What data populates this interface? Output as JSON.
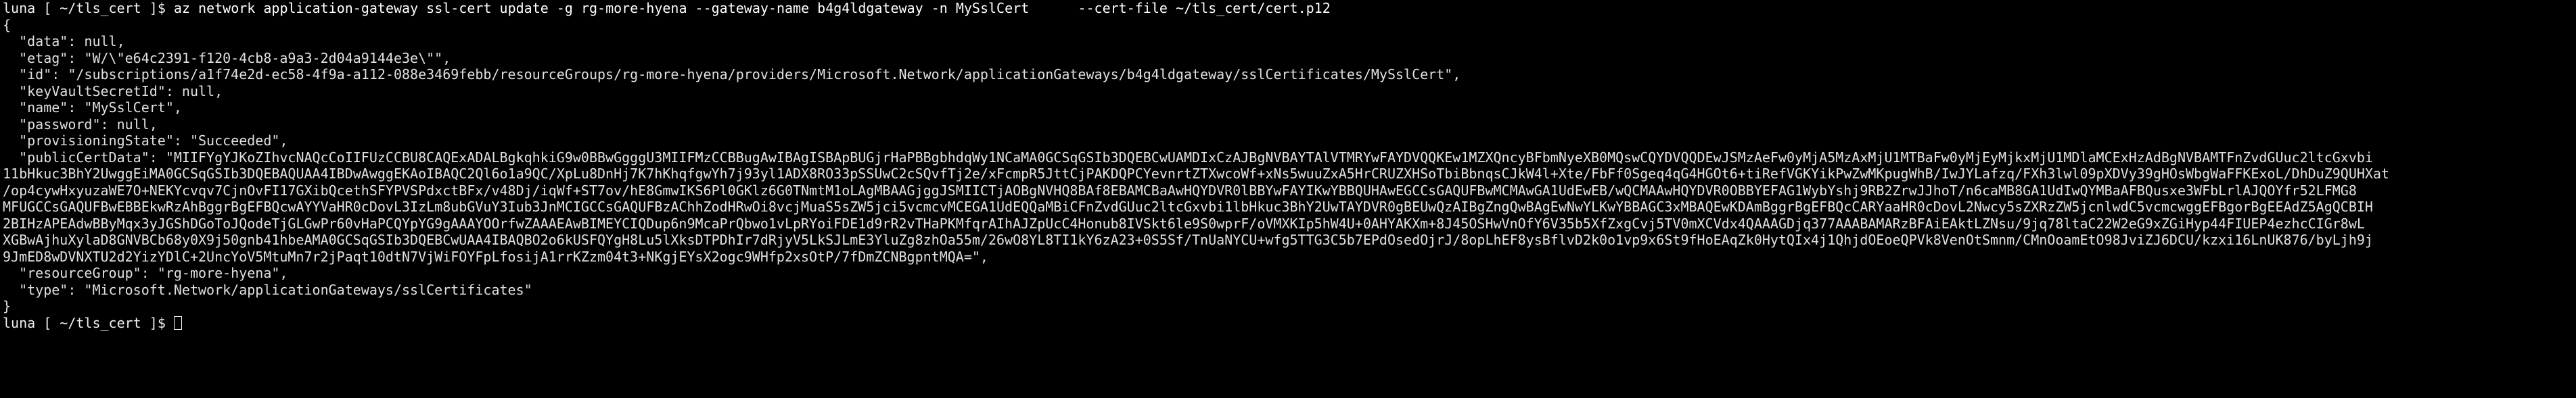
{
  "prompt": {
    "user": "luna",
    "cwd": "~/tls_cert",
    "symbol": "$"
  },
  "command": "az network application-gateway ssl-cert update -g rg-more-hyena --gateway-name b4g4ldgateway -n MySslCert      --cert-file ~/tls_cert/cert.p12",
  "output": {
    "open_brace": "{",
    "data_line": "  \"data\": null,",
    "etag_line": "  \"etag\": \"W/\\\"e64c2391-f120-4cb8-a9a3-2d04a9144e3e\\\"\",",
    "id_line": "  \"id\": \"/subscriptions/a1f74e2d-ec58-4f9a-a112-088e3469febb/resourceGroups/rg-more-hyena/providers/Microsoft.Network/applicationGateways/b4g4ldgateway/sslCertificates/MySslCert\",",
    "keyvault_line": "  \"keyVaultSecretId\": null,",
    "name_line": "  \"name\": \"MySslCert\",",
    "password_line": "  \"password\": null,",
    "provisioning_line": "  \"provisioningState\": \"Succeeded\",",
    "public_cert_lines": [
      "  \"publicCertData\": \"MIIFYgYJKoZIhvcNAQcCoIIFUzCCBU8CAQExADALBgkqhkiG9w0BBwGgggU3MIIFMzCCBBugAwIBAgISBApBUGjrHaPBBgbhdqWy1NCaMA0GCSqGSIb3DQEBCwUAMDIxCzAJBgNVBAYTAlVTMRYwFAYDVQQKEw1MZXQncyBFbmNyeXB0MQswCQYDVQQDEwJSMzAeFw0yMjA5MzAxMjU1MTBaFw0yMjEyMjkxMjU1MDlaMCExHzAdBgNVBAMTFnZvdGUuc2ltcGxvbi",
      "11bHkuc3BhY2UwggEiMA0GCSqGSIb3DQEBAQUAA4IBDwAwggEKAoIBAQC2Ql6o1a9QC/XpLu8DnHj7K7hKhqfgwYh7j93yl1ADX8RO33pSSUwC2cSQvfTj2e/xFcmpR5JttCjPAKDQPCYevnrtZTXwcoWf+xNs5wuuZxA5HrCRUZXHSoTbiBbnqsCJkW4l+Xte/FbFf0Sgeq4qG4HGOt6+tiRefVGKYikPwZwMKpugWhB/IwJYLafzq/FXh3lwl09pXDVy39gHOsWbgWaFFKExoL/DhDuZ9QUHXat",
      "/op4cywHxyuzaWE7O+NEKYcvqv7CjnOvFI17GXibQcethSFYPVSPdxctBFx/v48Dj/iqWf+ST7ov/hE8GmwIKS6Pl0GKlz6G0TNmtM1oLAgMBAAGjggJSMIICTjAOBgNVHQ8BAf8EBAMCBaAwHQYDVR0lBBYwFAYIKwYBBQUHAwEGCCsGAQUFBwMCMAwGA1UdEwEB/wQCMAAwHQYDVR0OBBYEFAG1WybYshj9RB2ZrwJJhoT/n6caMB8GA1UdIwQYMBaAFBQusxe3WFbLrlAJQOYfr52LFMG8",
      "MFUGCCsGAQUFBwEBBEkwRzAhBggrBgEFBQcwAYYVaHR0cDovL3IzLm8ubGVuY3Iub3JnMCIGCCsGAQUFBzAChhZodHRwOi8vcjMuaS5sZW5jci5vcmcvMCEGA1UdEQQaMBiCFnZvdGUuc2ltcGxvbi1lbHkuc3BhY2UwTAYDVR0gBEUwQzAIBgZngQwBAgEwNwYLKwYBBAGC3xMBAQEwKDAmBggrBgEFBQcCARYaaHR0cDovL2Nwcy5sZXRzZW5jcnlwdC5vcmcwggEFBgorBgEEAdZ5AgQCBIH",
      "2BIHzAPEAdwBByMqx3yJGShDGoToJQodeTjGLGwPr60vHaPCQYpYG9gAAAYOOrfwZAAAEAwBIMEYCIQDup6n9McaPrQbwo1vLpRYoiFDE1d9rR2vTHaPKMfqrAIhAJZpUcC4Honub8IVSkt6le9S0wprF/oVMXKIp5hW4U+0AHYAKXm+8J45OSHwVnOfY6V35b5XfZxgCvj5TV0mXCVdx4QAAAGDjq377AAABAMARzBFAiEAktLZNsu/9jq78ltaC22W2eG9xZGiHyp44FIUEP4ezhcCIGr8wL",
      "XGBwAjhuXylaD8GNVBCb68y0X9j50gnb41hbeAMA0GCSqGSIb3DQEBCwUAA4IBAQBO2o6kUSFQYgH8Lu5lXksDTPDhIr7dRjyV5LkSJLmE3YluZg8zhOa55m/26wO8YL8TI1kY6zA23+0S5Sf/TnUaNYCU+wfg5TTG3C5b7EPdOsedOjrJ/8opLhEF8ysBflvD2k0o1vp9x6St9fHoEAqZk0HytQIx4j1QhjdOEoeQPVk8VenOtSmnm/CMnOoamEtO98JviZJ6DCU/kzxi16LnUK876/byLjh9j",
      "9JmED8wDVNXTU2d2YizYDlC+2UncYoV5MtuMn7r2jPaqt10dtN7VjWiFOYFpLfosijA1rrKZzm04t3+NKgjEYsX2ogc9WHfp2xsOtP/7fDmZCNBgpntMQA=\","
    ],
    "resource_group_line": "  \"resourceGroup\": \"rg-more-hyena\",",
    "type_line": "  \"type\": \"Microsoft.Network/applicationGateways/sslCertificates\"",
    "close_brace": "}"
  }
}
